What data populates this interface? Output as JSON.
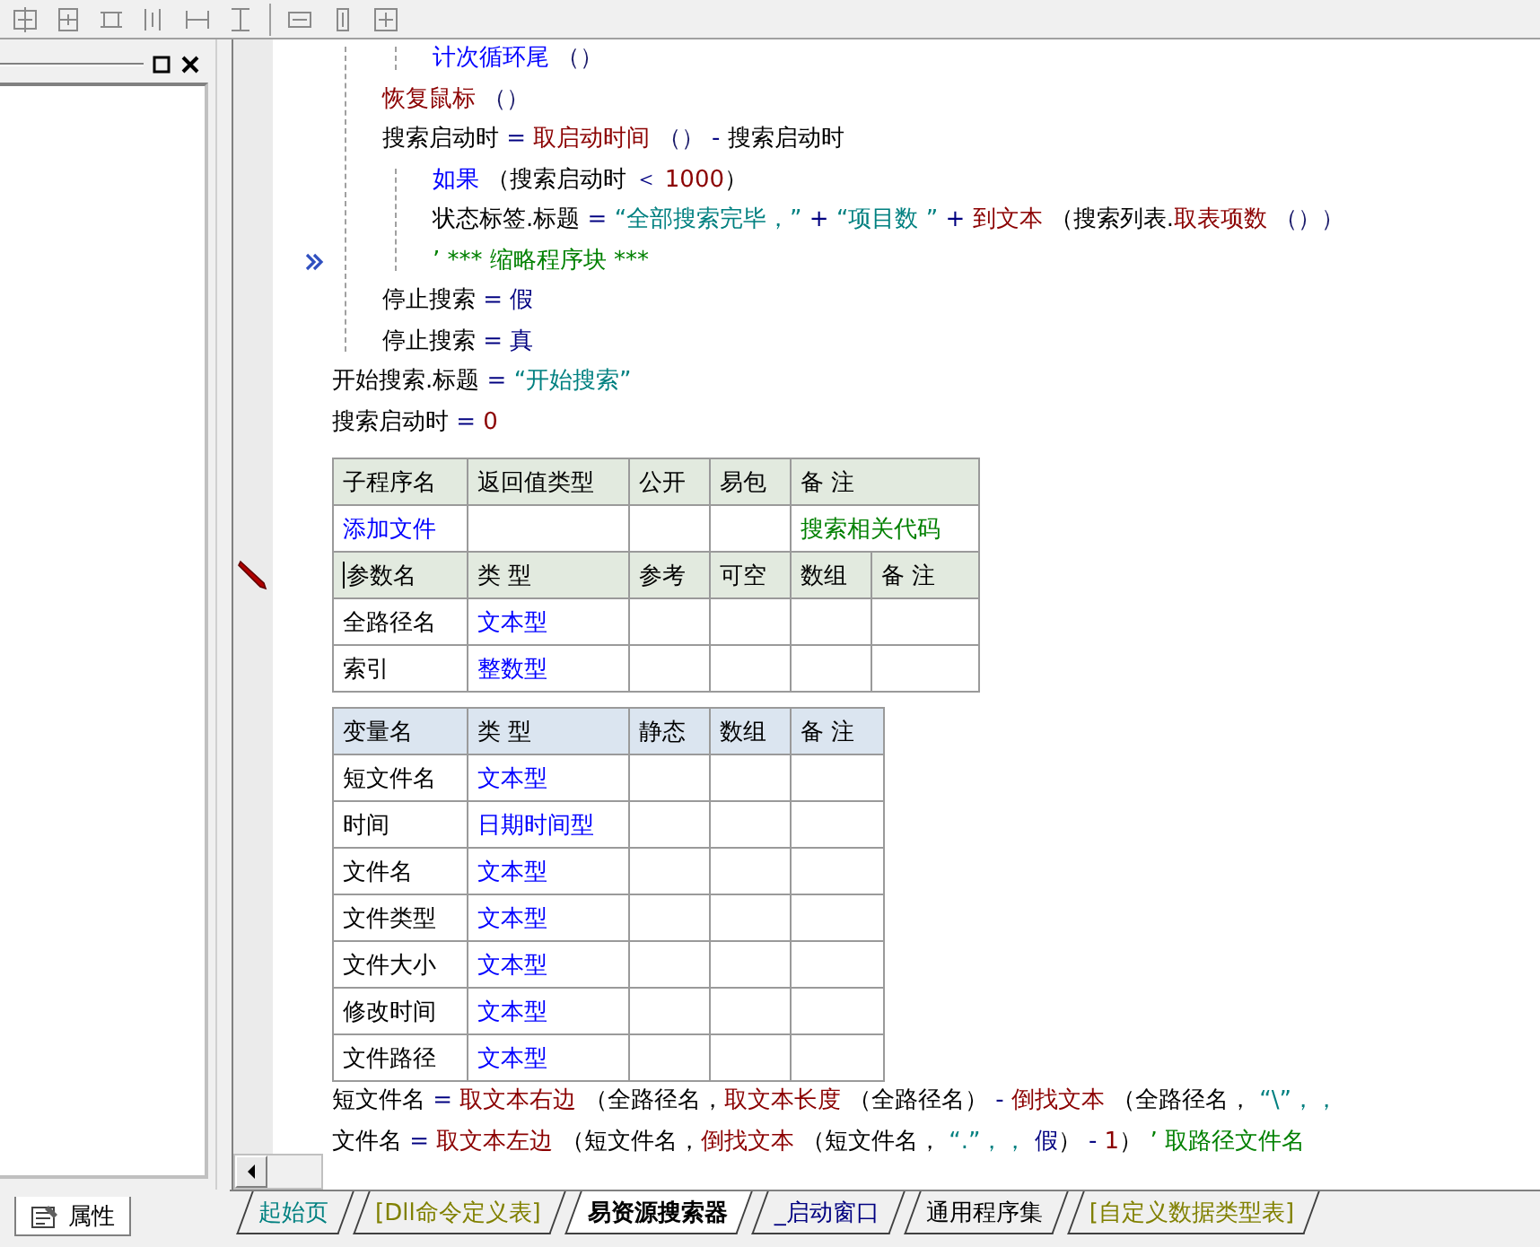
{
  "code_top": [
    {
      "children": [
        {
          "children": [
            {
              "tokens": [
                {
                  "kind": "keyword",
                  "text": "计次循环尾"
                },
                {
                  "kind": "plain",
                  "text": " （）"
                }
              ]
            }
          ]
        },
        {
          "tokens": [
            {
              "kind": "func",
              "text": "恢复鼠标"
            },
            {
              "kind": "plain",
              "text": " （）"
            }
          ]
        },
        {
          "tokens": [
            {
              "kind": "ident",
              "text": "搜索启动时"
            },
            {
              "kind": "op",
              "text": " = "
            },
            {
              "kind": "func",
              "text": "取启动时间"
            },
            {
              "kind": "plain",
              "text": " （） "
            },
            {
              "kind": "op",
              "text": "- "
            },
            {
              "kind": "ident",
              "text": "搜索启动时"
            }
          ]
        },
        {
          "children": [
            {
              "tokens": [
                {
                  "kind": "keyword",
                  "text": "如果"
                },
                {
                  "kind": "ident",
                  "text": " （搜索启动时 "
                },
                {
                  "kind": "op",
                  "text": "＜ "
                },
                {
                  "kind": "number",
                  "text": "1000"
                },
                {
                  "kind": "ident",
                  "text": "）"
                }
              ]
            },
            {
              "tokens": [
                {
                  "kind": "ident",
                  "text": "状态标签.标题"
                },
                {
                  "kind": "op",
                  "text": " = "
                },
                {
                  "kind": "string",
                  "text": "“全部搜索完毕，”"
                },
                {
                  "kind": "op",
                  "text": " + "
                },
                {
                  "kind": "string",
                  "text": "“项目数 ”"
                },
                {
                  "kind": "op",
                  "text": " + "
                },
                {
                  "kind": "func",
                  "text": "到文本"
                },
                {
                  "kind": "ident",
                  "text": " （搜索列表."
                },
                {
                  "kind": "func",
                  "text": "取表项数"
                },
                {
                  "kind": "plain",
                  "text": " （））"
                }
              ]
            },
            {
              "folded": true,
              "tokens": [
                {
                  "kind": "comment",
                  "text": "’ *** 缩略程序块 ***"
                }
              ]
            }
          ]
        },
        {
          "tokens": [
            {
              "kind": "ident",
              "text": "停止搜索"
            },
            {
              "kind": "op",
              "text": " = "
            },
            {
              "kind": "const",
              "text": "假"
            }
          ]
        },
        {
          "tokens": [
            {
              "kind": "ident",
              "text": "停止搜索"
            },
            {
              "kind": "op",
              "text": " = "
            },
            {
              "kind": "const",
              "text": "真"
            }
          ]
        }
      ]
    },
    {
      "tokens": [
        {
          "kind": "ident",
          "text": "开始搜索.标题"
        },
        {
          "kind": "op",
          "text": " = "
        },
        {
          "kind": "string",
          "text": "“开始搜索”"
        }
      ]
    },
    {
      "tokens": [
        {
          "kind": "ident",
          "text": "搜索启动时"
        },
        {
          "kind": "op",
          "text": " = "
        },
        {
          "kind": "number",
          "text": "0"
        }
      ]
    }
  ],
  "tables": [
    {
      "sections": [
        {
          "kind": "subroutine",
          "editing": false,
          "columns": [
            "子程序名",
            "返回值类型",
            "公开",
            "易包",
            "备 注"
          ],
          "rows": [
            [
              "添加文件",
              null,
              null,
              null,
              "搜索相关代码"
            ]
          ]
        },
        {
          "kind": "parameter",
          "editing": true,
          "columns": [
            "参数名",
            "类 型",
            "参考",
            "可空",
            "数组",
            "备 注"
          ],
          "rows": [
            [
              "全路径名",
              "文本型",
              null,
              null,
              null,
              null
            ],
            [
              "索引",
              "整数型",
              null,
              null,
              null,
              null
            ]
          ]
        }
      ]
    },
    {
      "sections": [
        {
          "kind": "variable",
          "editing": false,
          "columns": [
            "变量名",
            "类 型",
            "静态",
            "数组",
            "备 注"
          ],
          "rows": [
            [
              "短文件名",
              "文本型",
              null,
              null,
              null
            ],
            [
              "时间",
              "日期时间型",
              null,
              null,
              null
            ],
            [
              "文件名",
              "文本型",
              null,
              null,
              null
            ],
            [
              "文件类型",
              "文本型",
              null,
              null,
              null
            ],
            [
              "文件大小",
              "文本型",
              null,
              null,
              null
            ],
            [
              "修改时间",
              "文本型",
              null,
              null,
              null
            ],
            [
              "文件路径",
              "文本型",
              null,
              null,
              null
            ]
          ]
        }
      ]
    }
  ],
  "code_bottom": [
    {
      "tokens": [
        {
          "kind": "ident",
          "text": "短文件名"
        },
        {
          "kind": "op",
          "text": " = "
        },
        {
          "kind": "func",
          "text": "取文本右边"
        },
        {
          "kind": "ident",
          "text": " （全路径名，"
        },
        {
          "kind": "func",
          "text": "取文本长度"
        },
        {
          "kind": "ident",
          "text": " （全路径名） "
        },
        {
          "kind": "op",
          "text": "- "
        },
        {
          "kind": "func",
          "text": "倒找文本"
        },
        {
          "kind": "ident",
          "text": " （全路径名， "
        },
        {
          "kind": "string",
          "text": "“\\”，，"
        }
      ]
    },
    {
      "tokens": [
        {
          "kind": "ident",
          "text": "文件名"
        },
        {
          "kind": "op",
          "text": " = "
        },
        {
          "kind": "func",
          "text": "取文本左边"
        },
        {
          "kind": "ident",
          "text": " （短文件名，"
        },
        {
          "kind": "func",
          "text": "倒找文本"
        },
        {
          "kind": "ident",
          "text": " （短文件名， "
        },
        {
          "kind": "string",
          "text": "“.”，，"
        },
        {
          "kind": "const",
          "text": " 假"
        },
        {
          "kind": "ident",
          "text": "） "
        },
        {
          "kind": "op",
          "text": "- "
        },
        {
          "kind": "number",
          "text": "1"
        },
        {
          "kind": "ident",
          "text": "） "
        },
        {
          "kind": "comment",
          "text": "’ 取路径文件名"
        }
      ]
    }
  ],
  "side_tabs": [
    {
      "label": "属性",
      "selected": true
    }
  ],
  "doc_tabs": [
    {
      "label": "起始页",
      "selected": false,
      "color": "#008080"
    },
    {
      "label": "[Dll命令定义表]",
      "selected": false,
      "color": "#808000"
    },
    {
      "label": "易资源搜索器",
      "selected": true,
      "color": "#000000"
    },
    {
      "label": "_启动窗口",
      "selected": false,
      "color": "#000080"
    },
    {
      "label": "通用程序集",
      "selected": false,
      "color": "#000000"
    },
    {
      "label": "[自定义数据类型表]",
      "selected": false,
      "color": "#808000"
    }
  ]
}
